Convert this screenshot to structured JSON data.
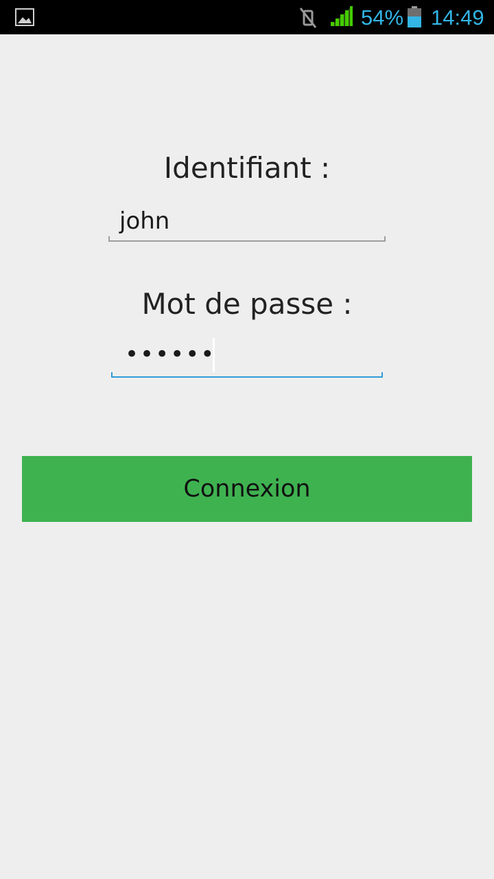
{
  "status_bar": {
    "left_icon": "image-icon",
    "mute_icon": "vibrate-off-icon",
    "signal_icon": "cell-signal-icon",
    "battery_percent": "54%",
    "battery_icon": "battery-icon",
    "time": "14:49",
    "colors": {
      "accent": "#33b5e5",
      "signal": "#44cc00"
    }
  },
  "form": {
    "username_label": "Identifiant :",
    "username_value": "john",
    "password_label": "Mot de passe :",
    "password_value": "••••••"
  },
  "login_button": {
    "label": "Connexion",
    "color": "#3fb250"
  },
  "colors": {
    "background": "#eeeeee",
    "field_inactive": "#9e9e9e",
    "field_focused": "#2e9bd6"
  }
}
